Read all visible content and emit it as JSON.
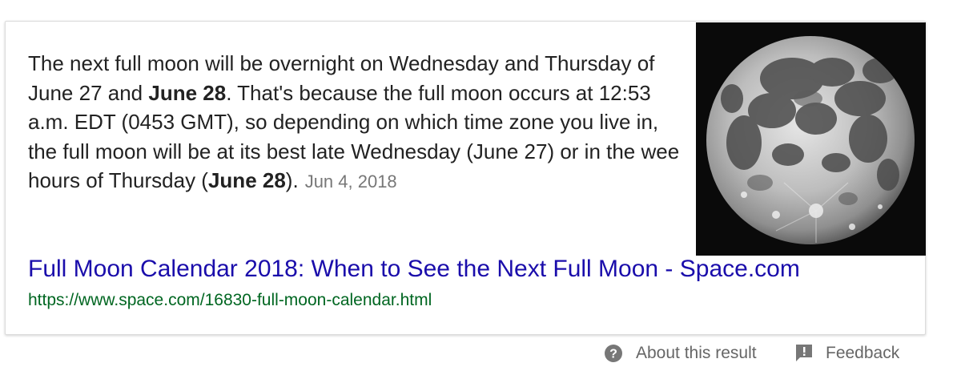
{
  "snippet": {
    "text_1": "The next full moon will be overnight on Wednesday and Thursday of June 27 and ",
    "bold_1": "June 28",
    "text_2": ". That's because the full moon occurs at 12:53 a.m. EDT (0453 GMT), so depending on which time zone you live in, the full moon will be at its best late Wednesday (June 27) or in the wee hours of Thursday (",
    "bold_2": "June 28",
    "text_3": ").",
    "date": "Jun 4, 2018"
  },
  "image": {
    "description_icon": "full-moon-photo"
  },
  "result": {
    "title": "Full Moon Calendar 2018: When to See the Next Full Moon - Space.com",
    "url": "https://www.space.com/16830-full-moon-calendar.html"
  },
  "footer": {
    "about_icon": "question-circle-icon",
    "about_label": "About this result",
    "feedback_icon": "feedback-flag-icon",
    "feedback_label": "Feedback"
  },
  "colors": {
    "link": "#1a0dab",
    "url": "#006621",
    "text": "#222222",
    "muted": "#777777"
  }
}
